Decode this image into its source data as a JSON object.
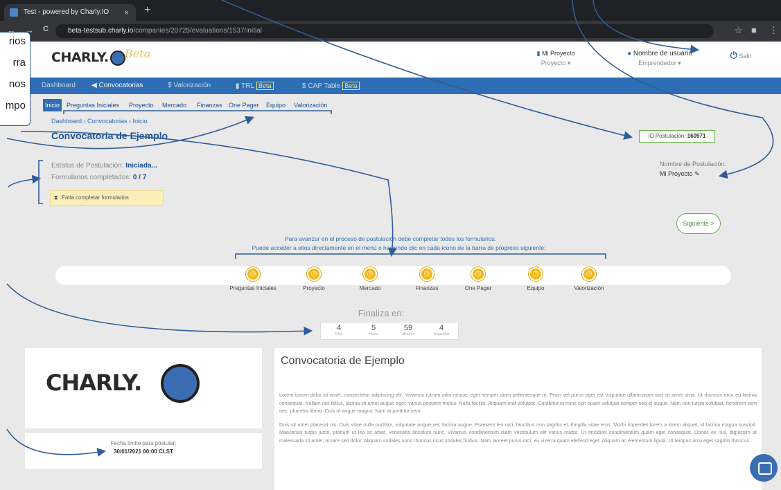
{
  "browser": {
    "tab_title": "Test - powered by Charly.IO",
    "tab_close": "×",
    "new_tab": "+",
    "url_host": "beta-testsub.charly.io",
    "url_path": "/companies/20725/evaluations/1537/initial",
    "nav_icons": [
      "←",
      "→",
      "C"
    ]
  },
  "callout": {
    "lines": [
      "rios",
      "rra",
      "nos",
      "mpo"
    ]
  },
  "header": {
    "brand": "CHARLY.",
    "beta": "Beta",
    "project_label": "Mi Proyecto",
    "project_menu": "Proyecto ▾",
    "user_label": "Nombre de usuario",
    "user_role": "Emprendedor ▾",
    "logout": "Salir"
  },
  "bluenav": {
    "dashboard": "Dashboard",
    "convocatorias": "Convocatorias",
    "valorizacion": "Valorización",
    "trl": "TRL",
    "cap_table": "CAP Table",
    "beta": "Beta"
  },
  "subnav": [
    "Inicio",
    "Preguntas Iniciales",
    "Proyecto",
    "Mercado",
    "Finanzas",
    "One Pager",
    "Equipo",
    "Valorización"
  ],
  "breadcrumb": "Dashboard  ›  Convocatorias  ›  Inicio",
  "page_title": "Convocatoria de Ejemplo",
  "id_postulacion": {
    "label": "ID Postulación:",
    "value": "160971"
  },
  "status": {
    "label": "Estatus de Postulación:",
    "value": "Iniciada..."
  },
  "forms": {
    "label": "Formularios completados:",
    "value": "0 / 7"
  },
  "falta": "Falta completar formularios",
  "nombre_postulacion": {
    "label": "Nombre de Postulación:",
    "value": "Mi Proyecto"
  },
  "siguiente": "Siguiente >",
  "info_line1": "Para avanzar en el proceso de postulación debe completar todos los formularios.",
  "info_line2": "Puede acceder a ellos directamente en el menú o haciendo clic en cada ícono de la barra de progreso siguiente:",
  "steps": [
    "Preguntas Iniciales",
    "Proyecto",
    "Mercado",
    "Finanzas",
    "One Pager",
    "Equipo",
    "Valorización"
  ],
  "finaliza": "Finaliza en:",
  "countdown": [
    {
      "n": "4",
      "u": "Días"
    },
    {
      "n": "5",
      "u": "Horas"
    },
    {
      "n": "59",
      "u": "Minutos"
    },
    {
      "n": "4",
      "u": "Segundos"
    }
  ],
  "fecha": {
    "label": "Fecha límite para postular:",
    "value": "30/01/2021 00:00 CLST"
  },
  "description": {
    "title": "Convocatoria de Ejemplo",
    "p1": "Lorem ipsum dolor sit amet, consectetur adipiscing elit. Vivamus rutrum odio neque, eget semper diam pellentesque in. Proin vel purus eget est vulputate ullamcorper sed sit amet urna. Ut rhoncus arcu eu lacinia consequat. Nullam nisl tellus, lacinia sit amet augue eget, varius posuere metus. Nulla facilisi. Aliquam erat volutpat. Curabitur et nunc non quam volutpat semper sed id augue. Nam non turpis volutpat, hendrerit sem nec, pharetra libero. Duis ut augue magna. Nam at porttitor sem.",
    "p2": "Duis sit amet placerat nis. Duis vitae nulla porttitor, vulputate augue vel, lacinia augue. Praesent leo orci, faucibus non sagittis et, fringilla vitae eros. Morbi imperdiet lorem a lorem aliquet, id lacinia magna suscipit. Maecenas turpis justo, pretium ut leo sit amet, venenatis tincidunt nunc. Vivamus condimentum diam vestibulum elit varius mattis. Ut tincidunt condimentum quam eget consequat. Donec ex nisl, dignissim at malesuada sit amet, ornare sed dolor. Aliquam sodales nunc rhoncus risus sodales finibus. Nam laoreet purus orci, eu viverra quam eleifend eget. Aliquam ac elementum ligula. Ut tempus arcu eget sagittis rhoncus."
  },
  "colors": {
    "brand_blue": "#2e6db3",
    "step_yellow": "#f3b81a",
    "green": "#6ab04c"
  }
}
